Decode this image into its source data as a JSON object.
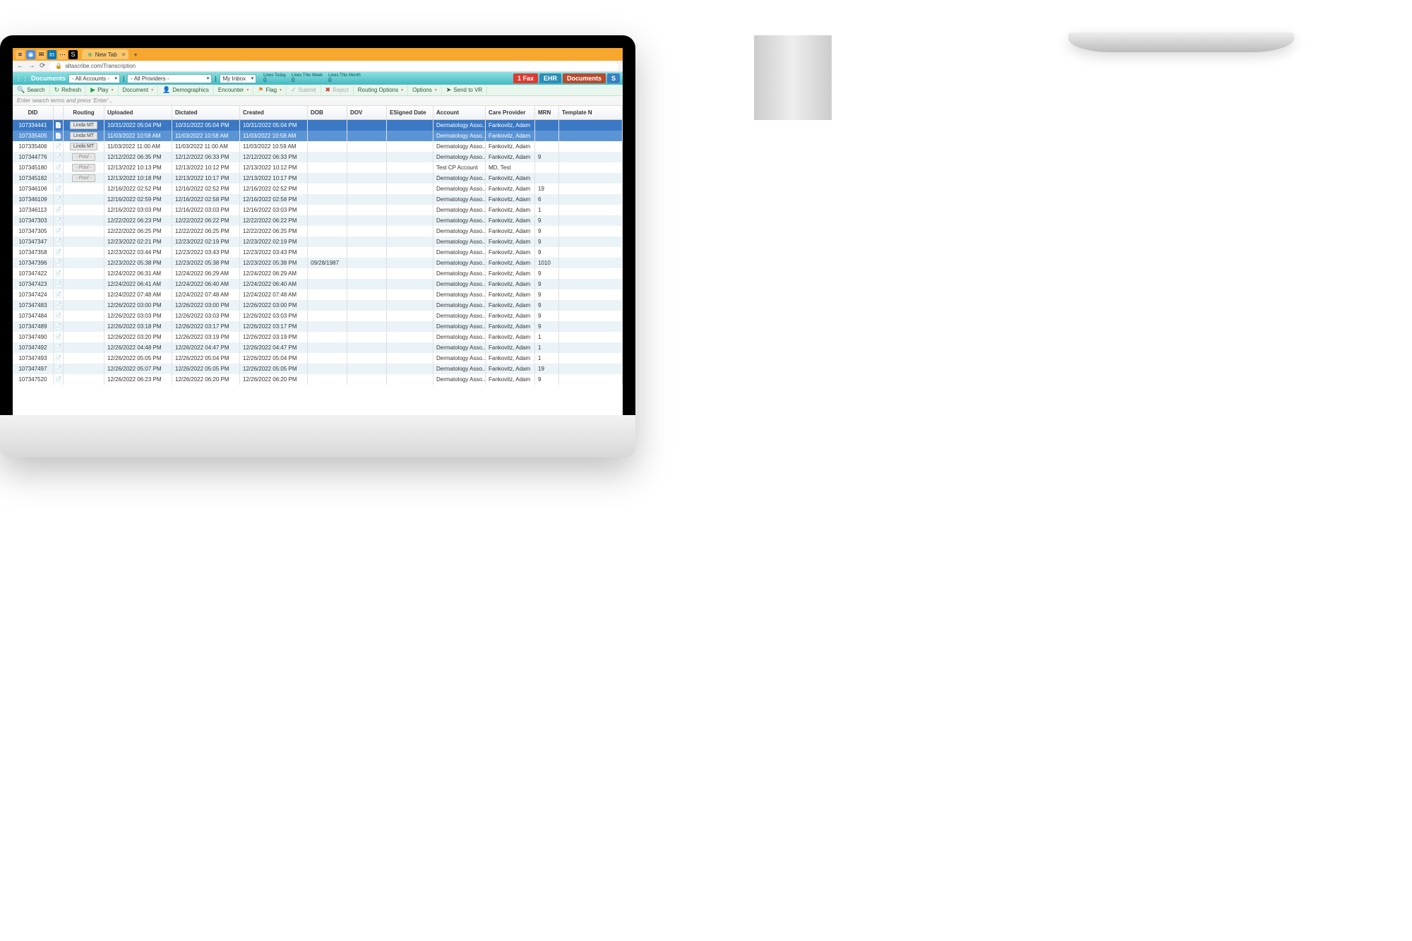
{
  "browser": {
    "tab_label": "New Tab",
    "url": "altascribe.com/Transcription"
  },
  "app": {
    "title": "Documents",
    "account_sel": "- All Accounts -",
    "provider_sel": "- All Providers -",
    "inbox_sel": "My Inbox",
    "stats": {
      "today_label": "Lines Today",
      "today_val": "0",
      "week_label": "Lines This Week",
      "week_val": "0",
      "month_label": "Lines This Month",
      "month_val": "0"
    },
    "fax_label": "1 Fax",
    "tabs": {
      "ehr": "EHR",
      "doc": "Documents",
      "s": "S"
    }
  },
  "toolbar": {
    "search": "Search",
    "refresh": "Refresh",
    "play": "Play",
    "document": "Document",
    "demo": "Demographics",
    "encounter": "Encounter",
    "flag": "Flag",
    "submit": "Submit",
    "reject": "Reject",
    "routing": "Routing Options",
    "options": "Options",
    "vr": "Send to VR"
  },
  "search_placeholder": "Enter search terms and press 'Enter'...",
  "columns": {
    "did": "DID",
    "routing": "Routing",
    "uploaded": "Uploaded",
    "dictated": "Dictated",
    "created": "Created",
    "dob": "DOB",
    "dov": "DOV",
    "esigned": "ESigned Date",
    "account": "Account",
    "care": "Care Provider",
    "mrn": "MRN",
    "tn": "Template N"
  },
  "rows": [
    {
      "did": "107334441",
      "rt": "Linda MT",
      "up": "10/31/2022 05:04 PM",
      "dc": "10/31/2022 05:04 PM",
      "cr": "10/31/2022 05:04 PM",
      "dob": "",
      "ac": "Dermatology Asso...",
      "cp": "Fankovitz, Adam",
      "mrn": "",
      "sel": 1
    },
    {
      "did": "107335405",
      "rt": "Linda MT",
      "up": "11/03/2022 10:58 AM",
      "dc": "11/03/2022 10:58 AM",
      "cr": "11/03/2022 10:58 AM",
      "dob": "",
      "ac": "Dermatology Asso...",
      "cp": "Fankovitz, Adam",
      "mrn": "",
      "sel": 2
    },
    {
      "did": "107335406",
      "rt": "Linda MT",
      "up": "11/03/2022 11:00 AM",
      "dc": "11/03/2022 11:00 AM",
      "cr": "11/03/2022 10:59 AM",
      "dob": "",
      "ac": "Dermatology Asso...",
      "cp": "Fankovitz, Adam",
      "mrn": ""
    },
    {
      "did": "107344776",
      "rt": "- Pool -",
      "up": "12/12/2022 06:35 PM",
      "dc": "12/12/2022 06:33 PM",
      "cr": "12/12/2022 06:33 PM",
      "dob": "",
      "ac": "Dermatology Asso...",
      "cp": "Fankovitz, Adam",
      "mrn": "9"
    },
    {
      "did": "107345180",
      "rt": "- Pool -",
      "up": "12/13/2022 10:13 PM",
      "dc": "12/13/2022 10:12 PM",
      "cr": "12/13/2022 10:12 PM",
      "dob": "",
      "ac": "Test CP Account",
      "cp": "MD, Test",
      "mrn": ""
    },
    {
      "did": "107345182",
      "rt": "- Pool -",
      "up": "12/13/2022 10:18 PM",
      "dc": "12/13/2022 10:17 PM",
      "cr": "12/13/2022 10:17 PM",
      "dob": "",
      "ac": "Dermatology Asso...",
      "cp": "Fankovitz, Adam",
      "mrn": ""
    },
    {
      "did": "107346106",
      "rt": "",
      "up": "12/16/2022 02:52 PM",
      "dc": "12/16/2022 02:52 PM",
      "cr": "12/16/2022 02:52 PM",
      "dob": "",
      "ac": "Dermatology Asso...",
      "cp": "Fankovitz, Adam",
      "mrn": "19"
    },
    {
      "did": "107346109",
      "rt": "",
      "up": "12/16/2022 02:59 PM",
      "dc": "12/16/2022 02:58 PM",
      "cr": "12/16/2022 02:58 PM",
      "dob": "",
      "ac": "Dermatology Asso...",
      "cp": "Fankovitz, Adam",
      "mrn": "6"
    },
    {
      "did": "107346113",
      "rt": "",
      "up": "12/16/2022 03:03 PM",
      "dc": "12/16/2022 03:03 PM",
      "cr": "12/16/2022 03:03 PM",
      "dob": "",
      "ac": "Dermatology Asso...",
      "cp": "Fankovitz, Adam",
      "mrn": "1"
    },
    {
      "did": "107347303",
      "rt": "",
      "up": "12/22/2022 06:23 PM",
      "dc": "12/22/2022 06:22 PM",
      "cr": "12/22/2022 06:22 PM",
      "dob": "",
      "ac": "Dermatology Asso...",
      "cp": "Fankovitz, Adam",
      "mrn": "9"
    },
    {
      "did": "107347305",
      "rt": "",
      "up": "12/22/2022 06:25 PM",
      "dc": "12/22/2022 06:25 PM",
      "cr": "12/22/2022 06:25 PM",
      "dob": "",
      "ac": "Dermatology Asso...",
      "cp": "Fankovitz, Adam",
      "mrn": "9"
    },
    {
      "did": "107347347",
      "rt": "",
      "up": "12/23/2022 02:21 PM",
      "dc": "12/23/2022 02:19 PM",
      "cr": "12/23/2022 02:19 PM",
      "dob": "",
      "ac": "Dermatology Asso...",
      "cp": "Fankovitz, Adam",
      "mrn": "9"
    },
    {
      "did": "107347358",
      "rt": "",
      "up": "12/23/2022 03:44 PM",
      "dc": "12/23/2022 03:43 PM",
      "cr": "12/23/2022 03:43 PM",
      "dob": "",
      "ac": "Dermatology Asso...",
      "cp": "Fankovitz, Adam",
      "mrn": "9"
    },
    {
      "did": "107347396",
      "rt": "",
      "up": "12/23/2022 05:38 PM",
      "dc": "12/23/2022 05:38 PM",
      "cr": "12/23/2022 05:38 PM",
      "dob": "09/28/1987",
      "ac": "Dermatology Asso...",
      "cp": "Fankovitz, Adam",
      "mrn": "1010"
    },
    {
      "did": "107347422",
      "rt": "",
      "up": "12/24/2022 06:31 AM",
      "dc": "12/24/2022 06:29 AM",
      "cr": "12/24/2022 06:29 AM",
      "dob": "",
      "ac": "Dermatology Asso...",
      "cp": "Fankovitz, Adam",
      "mrn": "9"
    },
    {
      "did": "107347423",
      "rt": "",
      "up": "12/24/2022 06:41 AM",
      "dc": "12/24/2022 06:40 AM",
      "cr": "12/24/2022 06:40 AM",
      "dob": "",
      "ac": "Dermatology Asso...",
      "cp": "Fankovitz, Adam",
      "mrn": "9"
    },
    {
      "did": "107347424",
      "rt": "",
      "up": "12/24/2022 07:48 AM",
      "dc": "12/24/2022 07:48 AM",
      "cr": "12/24/2022 07:48 AM",
      "dob": "",
      "ac": "Dermatology Asso...",
      "cp": "Fankovitz, Adam",
      "mrn": "9"
    },
    {
      "did": "107347483",
      "rt": "",
      "up": "12/26/2022 03:00 PM",
      "dc": "12/26/2022 03:00 PM",
      "cr": "12/26/2022 03:00 PM",
      "dob": "",
      "ac": "Dermatology Asso...",
      "cp": "Fankovitz, Adam",
      "mrn": "9"
    },
    {
      "did": "107347484",
      "rt": "",
      "up": "12/26/2022 03:03 PM",
      "dc": "12/26/2022 03:03 PM",
      "cr": "12/26/2022 03:03 PM",
      "dob": "",
      "ac": "Dermatology Asso...",
      "cp": "Fankovitz, Adam",
      "mrn": "9"
    },
    {
      "did": "107347489",
      "rt": "",
      "up": "12/26/2022 03:18 PM",
      "dc": "12/26/2022 03:17 PM",
      "cr": "12/26/2022 03:17 PM",
      "dob": "",
      "ac": "Dermatology Asso...",
      "cp": "Fankovitz, Adam",
      "mrn": "9"
    },
    {
      "did": "107347490",
      "rt": "",
      "up": "12/26/2022 03:20 PM",
      "dc": "12/26/2022 03:19 PM",
      "cr": "12/26/2022 03:19 PM",
      "dob": "",
      "ac": "Dermatology Asso...",
      "cp": "Fankovitz, Adam",
      "mrn": "1"
    },
    {
      "did": "107347492",
      "rt": "",
      "up": "12/26/2022 04:48 PM",
      "dc": "12/26/2022 04:47 PM",
      "cr": "12/26/2022 04:47 PM",
      "dob": "",
      "ac": "Dermatology Asso...",
      "cp": "Fankovitz, Adam",
      "mrn": "1"
    },
    {
      "did": "107347493",
      "rt": "",
      "up": "12/26/2022 05:05 PM",
      "dc": "12/26/2022 05:04 PM",
      "cr": "12/26/2022 05:04 PM",
      "dob": "",
      "ac": "Dermatology Asso...",
      "cp": "Fankovitz, Adam",
      "mrn": "1"
    },
    {
      "did": "107347497",
      "rt": "",
      "up": "12/26/2022 05:07 PM",
      "dc": "12/26/2022 05:05 PM",
      "cr": "12/26/2022 05:05 PM",
      "dob": "",
      "ac": "Dermatology Asso...",
      "cp": "Fankovitz, Adam",
      "mrn": "19"
    },
    {
      "did": "107347520",
      "rt": "",
      "up": "12/26/2022 06:23 PM",
      "dc": "12/26/2022 06:20 PM",
      "cr": "12/26/2022 06:20 PM",
      "dob": "",
      "ac": "Dermatology Asso...",
      "cp": "Fankovitz, Adam",
      "mrn": "9"
    }
  ]
}
